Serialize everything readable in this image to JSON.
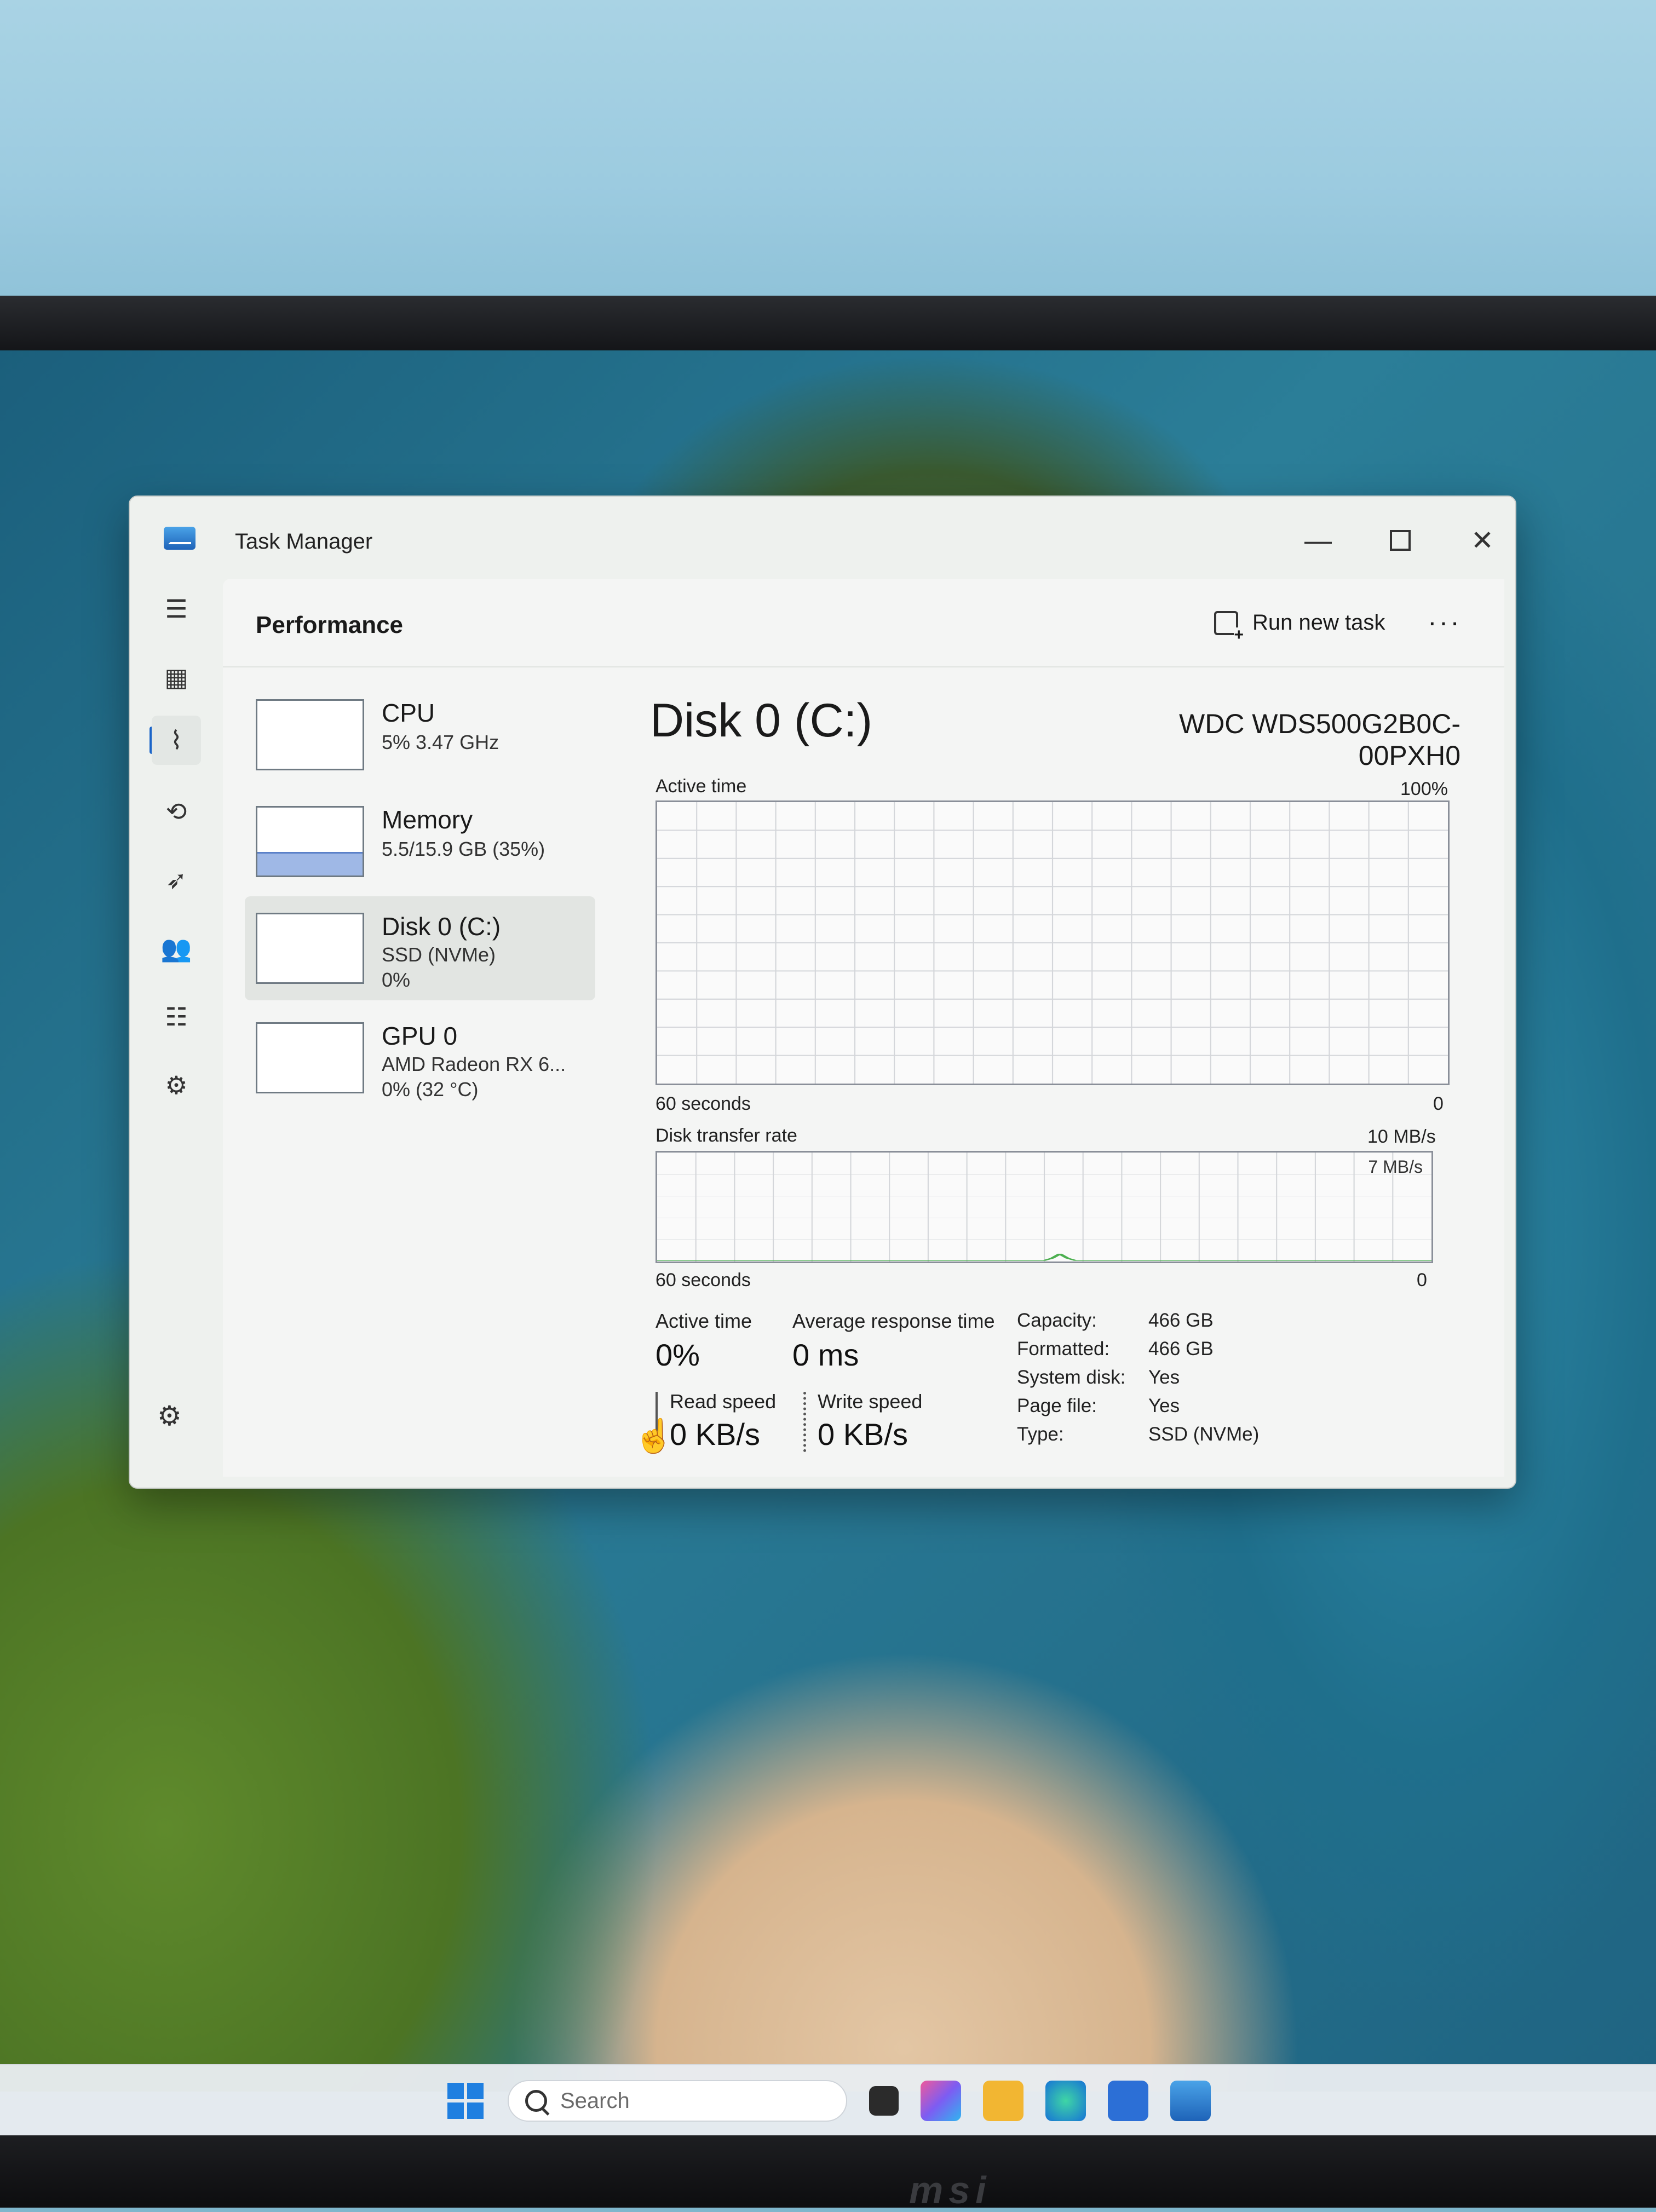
{
  "window": {
    "title": "Task Manager",
    "minimize_glyph": "—",
    "close_glyph": "✕"
  },
  "header": {
    "title": "Performance",
    "run_new_task": "Run new task",
    "more_glyph": "···"
  },
  "nav": [
    {
      "icon": "hamburger-icon",
      "glyph": "☰"
    },
    {
      "icon": "processes-icon",
      "glyph": "▦"
    },
    {
      "icon": "performance-icon",
      "glyph": "⌇",
      "active": true
    },
    {
      "icon": "app-history-icon",
      "glyph": "⟲"
    },
    {
      "icon": "startup-apps-icon",
      "glyph": "➶"
    },
    {
      "icon": "users-icon",
      "glyph": "👥"
    },
    {
      "icon": "details-icon",
      "glyph": "☷"
    },
    {
      "icon": "services-icon",
      "glyph": "⚙"
    }
  ],
  "settings_glyph": "⚙",
  "resources": [
    {
      "name": "CPU",
      "line1": "5% 3.47 GHz",
      "line2": ""
    },
    {
      "name": "Memory",
      "line1": "5.5/15.9 GB (35%)",
      "line2": ""
    },
    {
      "name": "Disk 0 (C:)",
      "line1": "SSD (NVMe)",
      "line2": "0%",
      "selected": true
    },
    {
      "name": "GPU 0",
      "line1": "AMD Radeon RX 6...",
      "line2": "0% (32 °C)"
    }
  ],
  "detail": {
    "title": "Disk 0 (C:)",
    "model": "WDC WDS500G2B0C-00PXH0",
    "active_time_chart": {
      "label": "Active time",
      "max_label": "100%",
      "time_label": "60 seconds",
      "min_label": "0"
    },
    "transfer_chart": {
      "label": "Disk transfer rate",
      "max_label": "10 MB/s",
      "inner_label": "7 MB/s",
      "time_label": "60 seconds",
      "min_label": "0"
    },
    "stats": {
      "active_time_label": "Active time",
      "active_time_value": "0%",
      "avg_response_label": "Average response time",
      "avg_response_value": "0 ms",
      "read_speed_label": "Read speed",
      "read_speed_value": "0 KB/s",
      "write_speed_label": "Write speed",
      "write_speed_value": "0 KB/s"
    },
    "properties": [
      {
        "key": "Capacity:",
        "value": "466 GB"
      },
      {
        "key": "Formatted:",
        "value": "466 GB"
      },
      {
        "key": "System disk:",
        "value": "Yes"
      },
      {
        "key": "Page file:",
        "value": "Yes"
      },
      {
        "key": "Type:",
        "value": "SSD (NVMe)"
      }
    ]
  },
  "taskbar": {
    "search_placeholder": "Search"
  },
  "brand_text": "msi",
  "colors": {
    "accent": "#1a64c8",
    "disk_chart_line": "#4caf50",
    "memory_fill": "#9fb8e6"
  }
}
